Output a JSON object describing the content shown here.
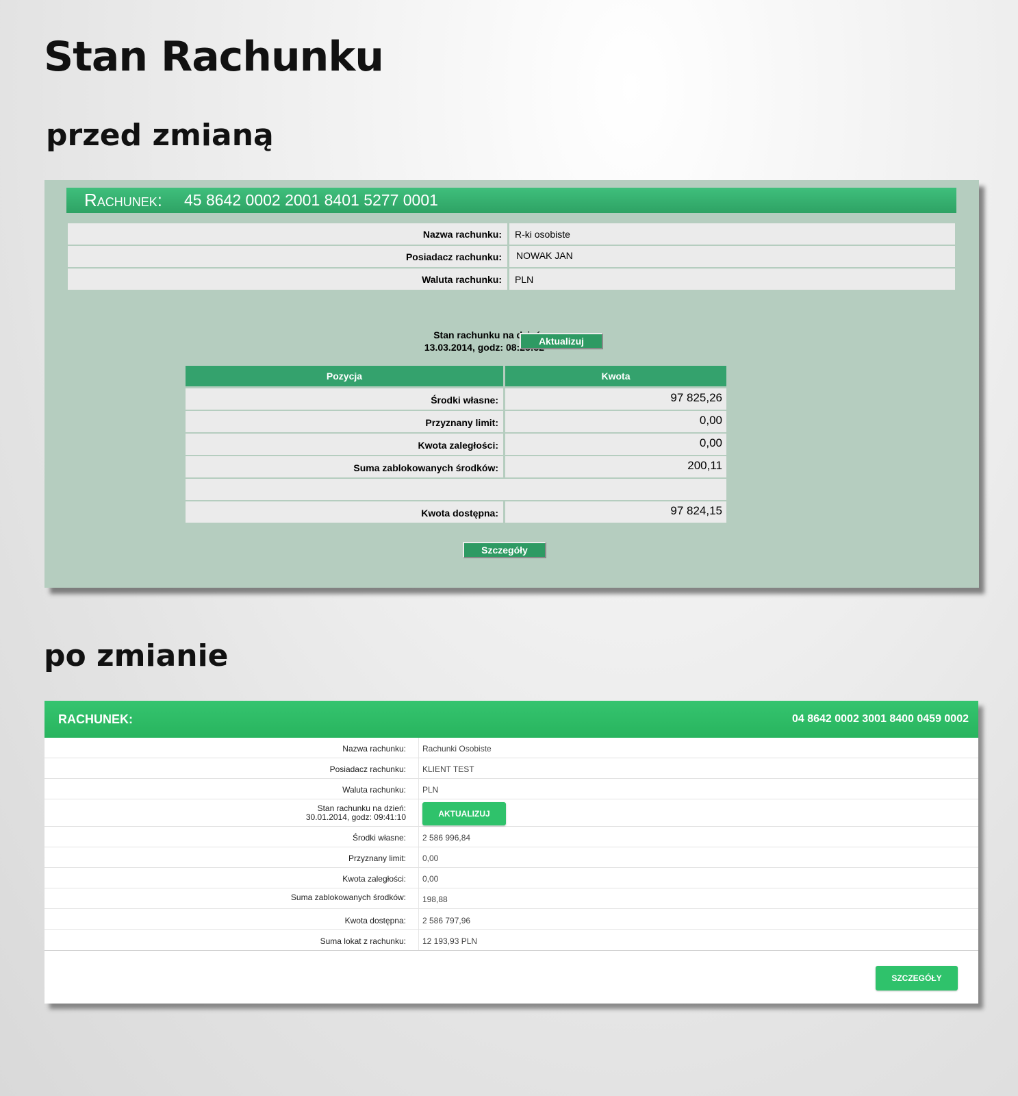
{
  "page": {
    "title": "Stan Rachunku",
    "before_label": "przed zmianą",
    "after_label": "po zmianie"
  },
  "before": {
    "header_label": "Rachunek:",
    "account_number": "45 8642 0002 2001 8401 5277 0001",
    "info": [
      {
        "label": "Nazwa rachunku:",
        "value": "R-ki osobiste"
      },
      {
        "label": "Posiadacz rachunku:",
        "value": "NOWAK JAN"
      },
      {
        "label": "Waluta rachunku:",
        "value": "PLN"
      }
    ],
    "balance_date_line1": "Stan rachunku na dzień:",
    "balance_date_line2": "13.03.2014, godz: 08:23:32",
    "update_button": "Aktualizuj",
    "table": {
      "headers": [
        "Pozycja",
        "Kwota"
      ],
      "rows": [
        {
          "label": "Środki własne:",
          "value": "97 825,26"
        },
        {
          "label": "Przyznany limit:",
          "value": "0,00"
        },
        {
          "label": "Kwota zaległości:",
          "value": "0,00"
        },
        {
          "label": "Suma zablokowanych środków:",
          "value": "200,11"
        },
        {
          "label": "",
          "value": ""
        },
        {
          "label": "Kwota dostępna:",
          "value": "97 824,15"
        }
      ]
    },
    "details_button": "Szczegóły"
  },
  "after": {
    "header_label": "RACHUNEK:",
    "account_number": "04 8642 0002 3001 8400 0459 0002",
    "rows": [
      {
        "label": "Nazwa rachunku:",
        "value": "Rachunki Osobiste"
      },
      {
        "label": "Posiadacz rachunku:",
        "value": "KLIENT TEST"
      },
      {
        "label": "Waluta rachunku:",
        "value": "PLN"
      },
      {
        "label": "Środki własne:",
        "value": "2 586 996,84"
      },
      {
        "label": "Przyznany limit:",
        "value": "0,00"
      },
      {
        "label": "Kwota zaległości:",
        "value": "0,00"
      },
      {
        "label": "Suma zablokowanych środków:",
        "value": "198,88"
      },
      {
        "label": "Kwota dostępna:",
        "value": "2 586 797,96"
      },
      {
        "label": "Suma lokat z rachunku:",
        "value": "12 193,93  PLN"
      }
    ],
    "balance_date_line1": "Stan rachunku na dzień:",
    "balance_date_line2": "30.01.2014, godz: 09:41:10",
    "update_button": "AKTUALIZUJ",
    "details_button": "SZCZEGÓŁY"
  },
  "colors": {
    "old_panel_bg": "#b5cdbf",
    "old_header": "#34a86c",
    "old_button": "#2e9a63",
    "new_header": "#2fbf68",
    "new_button": "#2fc26b"
  }
}
